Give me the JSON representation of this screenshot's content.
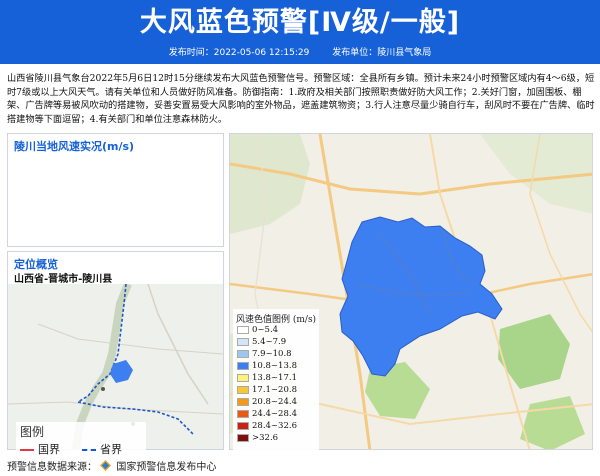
{
  "header": {
    "title": "大风蓝色预警[Ⅳ级/一般]",
    "publish_time": "发布时间：2022-05-06 12:15:29",
    "publisher": "发布单位：陵川县气象局"
  },
  "body_text": "山西省陵川县气象台2022年5月6日12时15分继续发布大风蓝色预警信号。预警区域：全县所有乡镇。预计未来24小时预警区域内有4～6级，短时7级或以上大风天气。请有关单位和人员做好防风准备。防御指南：1.政府及相关部门按照职责做好防大风工作；2.关好门窗，加固围板、棚架、广告牌等易被风吹动的搭建物，妥善安置易受大风影响的室外物品，遮盖建筑物资；3.行人注意尽量少骑自行车，刮风时不要在广告牌、临时搭建物等下面逗留；4.有关部门和单位注意森林防火。",
  "wind_panel": {
    "title": "陵川当地风速实况(m/s)"
  },
  "location_panel": {
    "title": "定位概览",
    "place": "山西省-晋城市-陵川县",
    "legend": {
      "title": "图例",
      "items": [
        {
          "label": "国界",
          "color": "#e0393e"
        },
        {
          "label": "省界",
          "color": "#1a57c9"
        }
      ]
    }
  },
  "wind_scale": {
    "title": "风速色值图例 (m/s)",
    "items": [
      {
        "label": "0~5.4",
        "color": "#ffffff"
      },
      {
        "label": "5.4~7.9",
        "color": "#d2e6f7"
      },
      {
        "label": "7.9~10.8",
        "color": "#9cc8ee"
      },
      {
        "label": "10.8~13.8",
        "color": "#3d7ef0"
      },
      {
        "label": "13.8~17.1",
        "color": "#fdf27a"
      },
      {
        "label": "17.1~20.8",
        "color": "#f8c832"
      },
      {
        "label": "20.8~24.4",
        "color": "#f39a16"
      },
      {
        "label": "24.4~28.4",
        "color": "#ea5a12"
      },
      {
        "label": "28.4~32.6",
        "color": "#c92213"
      },
      {
        "label": ">32.6",
        "color": "#7e1009"
      }
    ]
  },
  "colors": {
    "header_bg": "#1660d8",
    "county_fill": "#3d7ef0"
  },
  "footer": {
    "prefix": "预警信息数据来源：",
    "source": "国家预警信息发布中心"
  }
}
